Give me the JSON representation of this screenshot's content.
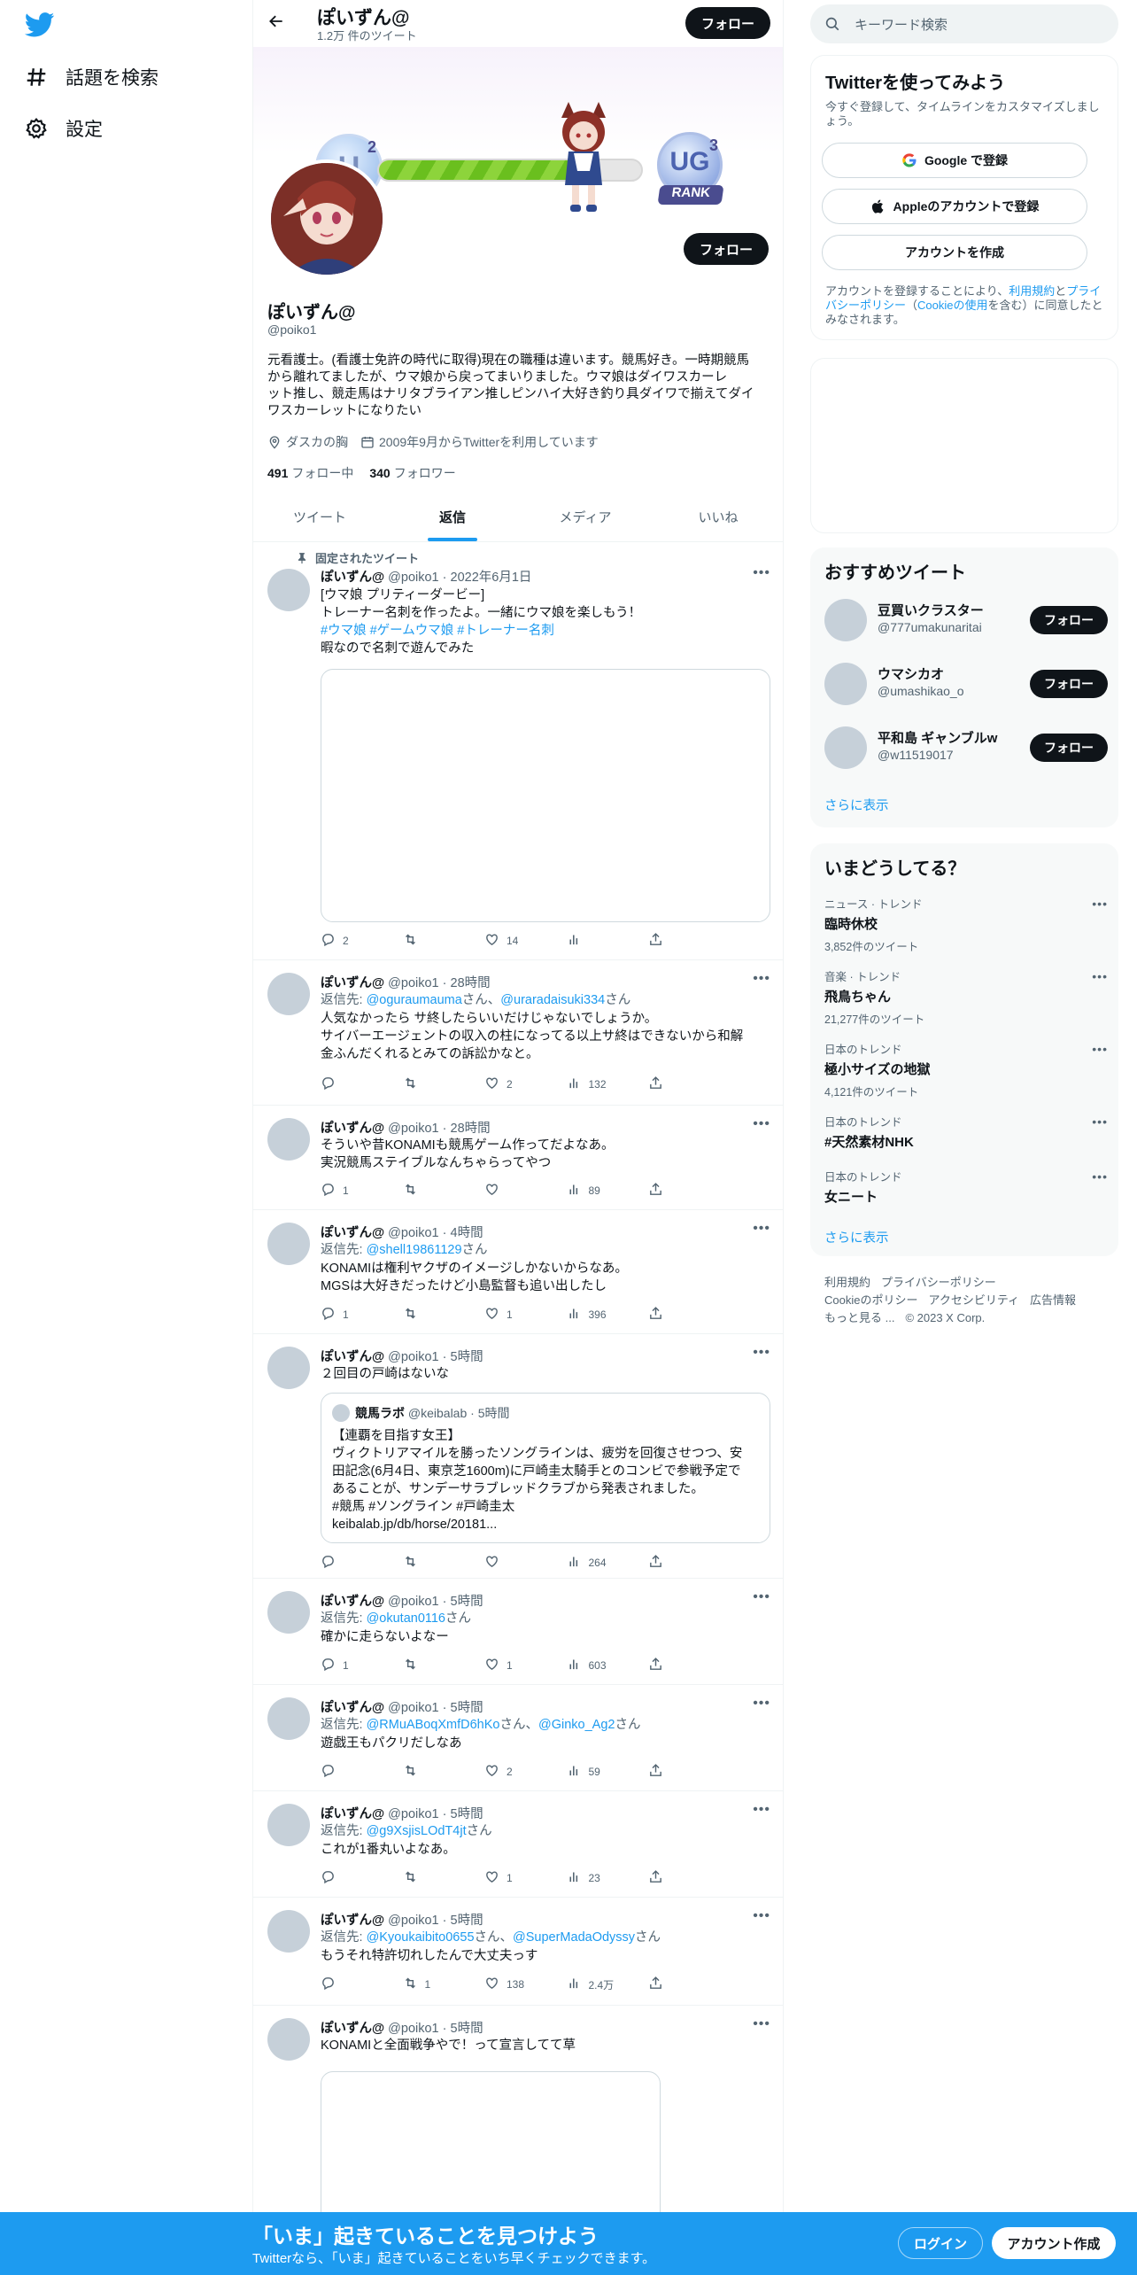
{
  "nav": {
    "explore_label": "話題を検索",
    "settings_label": "設定"
  },
  "header": {
    "name": "ぽいずん@",
    "tweet_count": "1.2万 件のツイート",
    "follow_label": "フォロー"
  },
  "banner": {
    "rank_left": "U",
    "rank_left_sup": "2",
    "rank_right": "UG",
    "rank_right_sup": "3",
    "rank_word": "RANK",
    "progress": 0.72
  },
  "profile": {
    "name": "ぽいずん@",
    "handle": "@poiko1",
    "follow_label": "フォロー",
    "bio_lines": [
      "元看護士。(看護士免許の時代に取得)現在の職種は違います。競馬好き。一時期競馬",
      "から離れてましたが、ウマ娘から戻ってまいりました。ウマ娘はダイワスカーレ",
      "ット推し、競走馬はナリタブライアン推しピンハイ大好き釣り具ダイワで揃えてダイ",
      "ワスカーレットになりたい"
    ],
    "location": "ダスカの胸",
    "joined": "2009年9月からTwitterを利用しています",
    "following_count": "491",
    "following_label": "フォロー中",
    "followers_count": "340",
    "followers_label": "フォロワー"
  },
  "tabs": [
    "ツイート",
    "返信",
    "メディア",
    "いいね"
  ],
  "pinned_label": "固定されたツイート",
  "tweets": [
    {
      "name": "ぽいずん@",
      "handle": "@poiko1",
      "time": "2022年6月1日",
      "lines": [
        "[ウマ娘 プリティーダービー]",
        "トレーナー名刺を作ったよ。一緒にウマ娘を楽しもう！"
      ],
      "tags": "#ウマ娘 #ゲームウマ娘 #トレーナー名刺",
      "extra": "暇なので名刺で遊んでみた",
      "reply": "2",
      "rt": "",
      "like": "14",
      "views": ""
    },
    {
      "name": "ぽいずん@",
      "handle": "@poiko1",
      "time": "28時間",
      "reply_prefix": "返信先: ",
      "reply_to_1": "@oguraumauma",
      "san1": "さん、",
      "reply_to_2": "@uraradaisuki334",
      "san2": "さん",
      "lines": [
        "人気なかったら サ終したらいいだけじゃないでしょうか。",
        "サイバーエージェントの収入の柱になってる以上サ終はできないから和解",
        "金ふんだくれるとみての訴訟かなと。"
      ],
      "reply": "",
      "rt": "",
      "like": "2",
      "views": "132"
    },
    {
      "name": "ぽいずん@",
      "handle": "@poiko1",
      "time": "28時間",
      "lines": [
        "そういや昔KONAMIも競馬ゲーム作ってだよなあ。",
        "実況競馬ステイブルなんちゃらってやつ"
      ],
      "reply": "1",
      "rt": "",
      "like": "",
      "views": "89"
    },
    {
      "name": "ぽいずん@",
      "handle": "@poiko1",
      "time": "4時間",
      "reply_prefix": "返信先: ",
      "reply_to_1": "@shell19861129",
      "san1": "さん",
      "lines": [
        "KONAMIは権利ヤクザのイメージしかないからなあ。",
        "MGSは大好きだったけど小島監督も追い出したし"
      ],
      "reply": "1",
      "rt": "",
      "like": "1",
      "views": "396"
    },
    {
      "name": "ぽいずん@",
      "handle": "@poiko1",
      "time": "5時間",
      "lines": [
        "２回目の戸崎はないな"
      ],
      "quote": {
        "name": "競馬ラボ",
        "handle": "@keibalab",
        "time": "5時間",
        "lines": [
          "【連覇を目指す女王】",
          "ヴィクトリアマイルを勝ったソングラインは、疲労を回復させつつ、安",
          "田記念(6月4日、東京芝1600m)に戸崎圭太騎手とのコンビで参戦予定で",
          "あることが、サンデーサラブレッドクラブから発表されました。",
          "#競馬 #ソングライン #戸崎圭太",
          "keibalab.jp/db/horse/20181..."
        ]
      },
      "reply": "",
      "rt": "",
      "like": "",
      "views": "264"
    },
    {
      "name": "ぽいずん@",
      "handle": "@poiko1",
      "time": "5時間",
      "reply_prefix": "返信先: ",
      "reply_to_1": "@okutan0116",
      "san1": "さん",
      "lines": [
        "確かに走らないよなー"
      ],
      "reply": "1",
      "rt": "",
      "like": "1",
      "views": "603"
    },
    {
      "name": "ぽいずん@",
      "handle": "@poiko1",
      "time": "5時間",
      "reply_prefix": "返信先: ",
      "reply_to_1": "@RMuABoqXmfD6hKo",
      "san1": "さん、",
      "reply_to_2": "@Ginko_Ag2",
      "san2": "さん",
      "lines": [
        "遊戯王もパクリだしなあ"
      ],
      "reply": "",
      "rt": "",
      "like": "2",
      "views": "59"
    },
    {
      "name": "ぽいずん@",
      "handle": "@poiko1",
      "time": "5時間",
      "reply_prefix": "返信先: ",
      "reply_to_1": "@g9XsjisLOdT4jt",
      "san1": "さん",
      "lines": [
        "これが1番丸いよなあ。"
      ],
      "reply": "",
      "rt": "",
      "like": "1",
      "views": "23"
    },
    {
      "name": "ぽいずん@",
      "handle": "@poiko1",
      "time": "5時間",
      "reply_prefix": "返信先: ",
      "reply_to_1": "@Kyoukaibito0655",
      "san1": "さん、",
      "reply_to_2": "@SuperMadaOdyssy",
      "san2": "さん",
      "lines": [
        "もうそれ特許切れしたんで大丈夫っす"
      ],
      "reply": "",
      "rt": "1",
      "like": "138",
      "views": "2.4万"
    },
    {
      "name": "ぽいずん@",
      "handle": "@poiko1",
      "time": "5時間",
      "lines": [
        "KONAMIと全面戦争やで！って宣言してて草"
      ]
    }
  ],
  "sidebar": {
    "search_placeholder": "キーワード検索",
    "signup": {
      "title": "Twitterを使ってみよう",
      "subtitle": "今すぐ登録して、タイムラインをカスタマイズしましょう。",
      "google": "Google で登録",
      "apple": "Appleのアカウントで登録",
      "create": "アカウントを作成",
      "terms_1": "アカウントを登録することにより、",
      "terms_link1": "利用規約",
      "terms_2": "と",
      "terms_link2": "プライバシーポリシー",
      "terms_3": "（",
      "terms_link3": "Cookieの使用",
      "terms_4": "を含む）に同意したとみなされます。"
    },
    "recommend": {
      "title": "おすすめツイート",
      "follow_label": "フォロー",
      "more": "さらに表示",
      "users": [
        {
          "name": "豆買いクラスター",
          "handle": "@777umakunaritai"
        },
        {
          "name": "ウマシカオ",
          "handle": "@umashikao_o"
        },
        {
          "name": "平和島 ギャンブルw",
          "handle": "@w11519017"
        }
      ]
    },
    "trends": {
      "title": "いまどうしてる？",
      "more": "さらに表示",
      "items": [
        {
          "ctx": "ニュース · トレンド",
          "title": "臨時休校",
          "count": "3,852件のツイート"
        },
        {
          "ctx": "音楽 · トレンド",
          "title": "飛鳥ちゃん",
          "count": "21,277件のツイート"
        },
        {
          "ctx": "日本のトレンド",
          "title": "極小サイズの地獄",
          "count": "4,121件のツイート"
        },
        {
          "ctx": "日本のトレンド",
          "title": "#天然素材NHK",
          "count": ""
        },
        {
          "ctx": "日本のトレンド",
          "title": "女ニート",
          "count": ""
        }
      ]
    },
    "footer": {
      "tos": "利用規約",
      "privacy": "プライバシーポリシー",
      "cookie": "Cookieのポリシー",
      "access": "アクセシビリティ",
      "ads": "広告情報",
      "more": "もっと見る ...",
      "copy": "© 2023 X Corp."
    }
  },
  "bottom": {
    "title": "「いま」起きていることを見つけよう",
    "subtitle": "Twitterなら、「いま」起きていることをいち早くチェックできます。",
    "login": "ログイン",
    "signup": "アカウント作成"
  },
  "colors": {
    "accent": "#1d9bf0",
    "text": "#0f1419",
    "secondary": "#536471"
  }
}
